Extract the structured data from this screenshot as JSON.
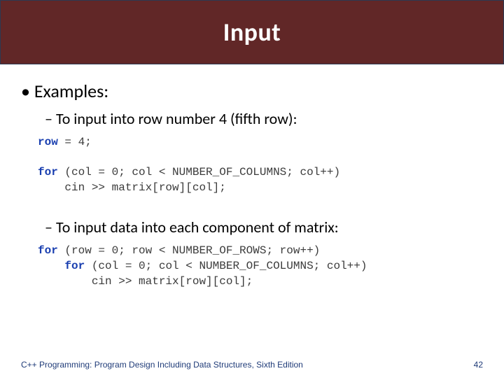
{
  "title": "Input",
  "bullets": {
    "examples": "Examples:",
    "sub1": "To input into row number 4 (fifth row):",
    "sub2": "To input data into each component of matrix:"
  },
  "code": {
    "block1": {
      "kw1": "row",
      "line1_rest": " = 4;",
      "kw2": "for",
      "line2_rest": " (col = 0; col < NUMBER_OF_COLUMNS; col++)",
      "line3": "    cin >> matrix[row][col];"
    },
    "block2": {
      "kw1": "for",
      "line1_rest": " (row = 0; row < NUMBER_OF_ROWS; row++)",
      "kw2": "for",
      "line2_prefix": "    ",
      "line2_rest": " (col = 0; col < NUMBER_OF_COLUMNS; col++)",
      "line3": "        cin >> matrix[row][col];"
    }
  },
  "footer": {
    "text": "C++ Programming: Program Design Including Data Structures, Sixth Edition",
    "page": "42"
  }
}
